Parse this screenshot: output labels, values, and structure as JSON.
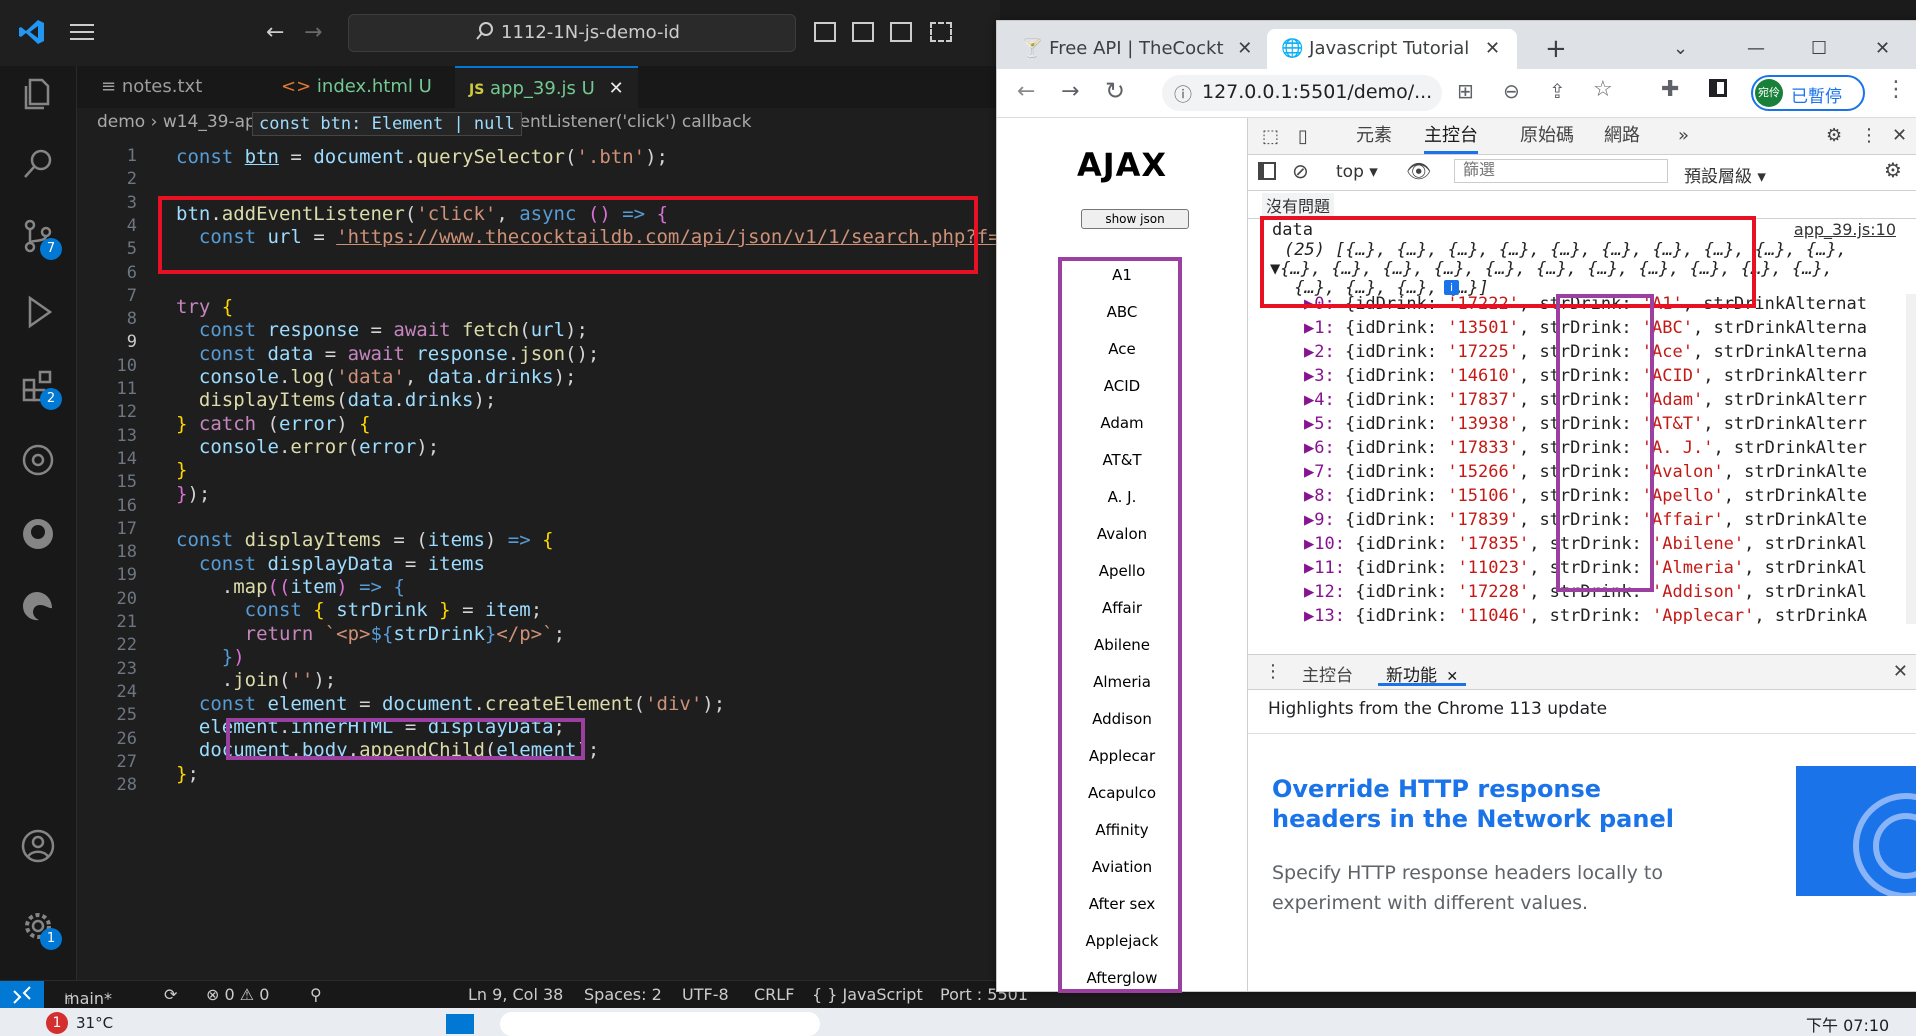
{
  "vscode": {
    "search_text": "1112-1N-js-demo-id",
    "tabs": [
      {
        "label": "notes.txt",
        "icon": "≡"
      },
      {
        "label": "index.html U",
        "icon": "<>"
      },
      {
        "label": "app_39.js U",
        "icon": "JS"
      }
    ],
    "breadcrumb": "demo › w14_39-app-more › app_39.js › btn.addEventListener('click') callback",
    "hover_hint": "const btn: Element | null",
    "line_numbers": [
      "1",
      "2",
      "3",
      "4",
      "5",
      "6",
      "7",
      "8",
      "9",
      "10",
      "11",
      "12",
      "13",
      "14",
      "15",
      "16",
      "17",
      "18",
      "19",
      "20",
      "21",
      "22",
      "23",
      "24",
      "25",
      "26",
      "27",
      "28"
    ],
    "activity_badges": {
      "source_control": "7",
      "extensions": "2",
      "settings": "1"
    },
    "status": {
      "branch": "main*",
      "problems": "⊗ 0 ⚠ 0",
      "position": "Ln 9, Col 38",
      "spaces": "Spaces: 2",
      "encoding": "UTF-8",
      "eol": "CRLF",
      "language": "{ } JavaScript",
      "port": "Port : 5501"
    }
  },
  "chrome": {
    "tabs": [
      {
        "title": "Free API | TheCockt"
      },
      {
        "title": "Javascript Tutorial"
      }
    ],
    "url": "127.0.0.1:5501/demo/...",
    "profile_label": "已暫停",
    "profile_avatar": "宛伶",
    "page": {
      "heading": "AJAX",
      "button": "show json",
      "drinks": [
        "A1",
        "ABC",
        "Ace",
        "ACID",
        "Adam",
        "AT&T",
        "A. J.",
        "Avalon",
        "Apello",
        "Affair",
        "Abilene",
        "Almeria",
        "Addison",
        "Applecar",
        "Acapulco",
        "Affinity",
        "Aviation",
        "After sex",
        "Applejack",
        "Afterglow"
      ]
    },
    "devtools": {
      "tabs": [
        "元素",
        "主控台",
        "原始碼",
        "網路"
      ],
      "context": "top ▾",
      "filter_placeholder": "篩選",
      "levels": "預設層級 ▾",
      "issues": "沒有問題",
      "log_label": "data",
      "log_source": "app_39.js:10",
      "array_summary_1": "(25) [{…}, {…}, {…}, {…}, {…}, {…}, {…}, {…}, {…}, {…},",
      "array_summary_2": "▼{…}, {…}, {…}, {…}, {…}, {…}, {…}, {…}, {…}, {…}, {…},",
      "array_summary_3": " {…}, {…}, {…}, {…}]",
      "rows": [
        {
          "i": "0",
          "id": "'17222'",
          "name": "'A1'",
          "tail": ", strDrinkAlternat"
        },
        {
          "i": "1",
          "id": "'13501'",
          "name": "'ABC'",
          "tail": ", strDrinkAlterna"
        },
        {
          "i": "2",
          "id": "'17225'",
          "name": "'Ace'",
          "tail": ", strDrinkAlterna"
        },
        {
          "i": "3",
          "id": "'14610'",
          "name": "'ACID'",
          "tail": ", strDrinkAlterr"
        },
        {
          "i": "4",
          "id": "'17837'",
          "name": "'Adam'",
          "tail": ", strDrinkAlterr"
        },
        {
          "i": "5",
          "id": "'13938'",
          "name": "'AT&T'",
          "tail": ", strDrinkAlterr"
        },
        {
          "i": "6",
          "id": "'17833'",
          "name": "'A. J.'",
          "tail": ", strDrinkAlter"
        },
        {
          "i": "7",
          "id": "'15266'",
          "name": "'Avalon'",
          "tail": ", strDrinkAlte"
        },
        {
          "i": "8",
          "id": "'15106'",
          "name": "'Apello'",
          "tail": ", strDrinkAlte"
        },
        {
          "i": "9",
          "id": "'17839'",
          "name": "'Affair'",
          "tail": ", strDrinkAlte"
        },
        {
          "i": "10",
          "id": "'17835'",
          "name": "'Abilene'",
          "tail": ", strDrinkAl"
        },
        {
          "i": "11",
          "id": "'11023'",
          "name": "'Almeria'",
          "tail": ", strDrinkAl"
        },
        {
          "i": "12",
          "id": "'17228'",
          "name": "'Addison'",
          "tail": ", strDrinkAl"
        },
        {
          "i": "13",
          "id": "'11046'",
          "name": "'Applecar'",
          "tail": ", strDrinkA"
        }
      ],
      "drawer_tabs": [
        "主控台",
        "新功能"
      ],
      "whatsnew_header": "Highlights from the Chrome 113 update",
      "whatsnew_title": "Override HTTP response headers in the Network panel",
      "whatsnew_body": "Specify HTTP response headers locally to experiment with different values."
    }
  },
  "taskbar": {
    "weather": "31°C",
    "clock": "下午 07:10"
  },
  "colors": {
    "highlight_red": "#e81123",
    "highlight_purple": "#9b3fa0",
    "vscode_blue": "#0078d4",
    "devtools_link": "#1a73e8"
  }
}
